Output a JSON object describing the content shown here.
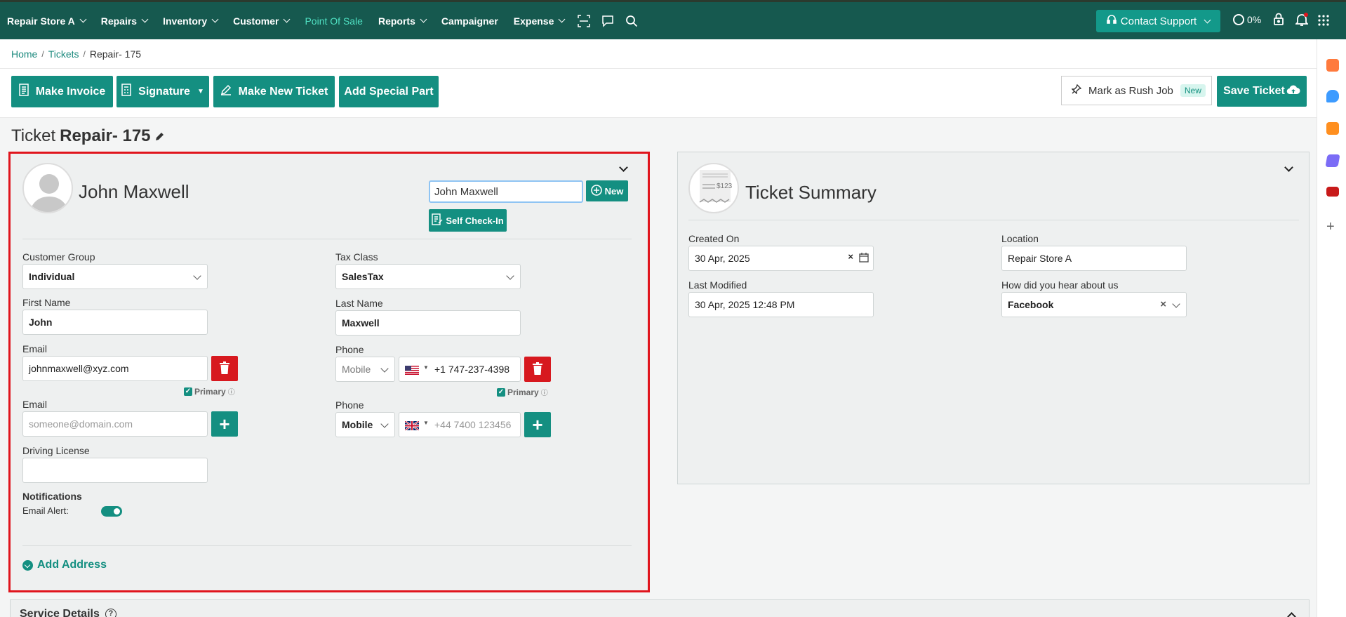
{
  "topnav": {
    "items": [
      {
        "label": "Repair Store A",
        "dropdown": true
      },
      {
        "label": "Repairs",
        "dropdown": true
      },
      {
        "label": "Inventory",
        "dropdown": true
      },
      {
        "label": "Customer",
        "dropdown": true
      },
      {
        "label": "Point Of Sale",
        "dropdown": false,
        "active": true
      },
      {
        "label": "Reports",
        "dropdown": true
      },
      {
        "label": "Campaigner",
        "dropdown": false
      },
      {
        "label": "Expense",
        "dropdown": true
      }
    ],
    "icons": [
      "scan-icon",
      "chat-icon",
      "search-icon"
    ],
    "support_label": "Contact Support",
    "progress": "0%",
    "right_icons": [
      "lock-icon",
      "bell-icon",
      "apps-grid-icon"
    ]
  },
  "breadcrumb": {
    "home": "Home",
    "tickets": "Tickets",
    "current": "Repair- 175"
  },
  "toolbar": {
    "make_invoice": "Make Invoice",
    "signature": "Signature",
    "make_new_ticket": "Make New Ticket",
    "add_special_part": "Add Special Part",
    "rush_job": "Mark as Rush Job",
    "rush_badge": "New",
    "save_ticket": "Save Ticket"
  },
  "page": {
    "title_prefix": "Ticket",
    "title_value": "Repair- 175"
  },
  "customer": {
    "name": "John Maxwell",
    "search_value": "John Maxwell",
    "new_label": "New",
    "self_checkin_label": "Self Check-In",
    "customer_group_label": "Customer Group",
    "customer_group": "Individual",
    "tax_class_label": "Tax Class",
    "tax_class": "SalesTax",
    "first_name_label": "First Name",
    "first_name": "John",
    "last_name_label": "Last Name",
    "last_name": "Maxwell",
    "email_label": "Email",
    "email": "johnmaxwell@xyz.com",
    "primary_label": "Primary",
    "email2_label": "Email",
    "email2_placeholder": "someone@domain.com",
    "phone_label": "Phone",
    "phone_type": "Mobile",
    "phone": "+1 747-237-4398",
    "phone2_label": "Phone",
    "phone2_type": "Mobile",
    "phone2_placeholder": "+44 7400 123456",
    "driving_license_label": "Driving License",
    "notifications_label": "Notifications",
    "email_alert_label": "Email Alert:",
    "email_alert_on": true,
    "add_address_label": "Add Address"
  },
  "summary": {
    "title": "Ticket Summary",
    "avatar_amount": "$123",
    "created_on_label": "Created On",
    "created_on": "30 Apr, 2025",
    "location_label": "Location",
    "location": "Repair Store A",
    "last_modified_label": "Last Modified",
    "last_modified": "30 Apr, 2025 12:48 PM",
    "hear_about_label": "How did you hear about us",
    "hear_about": "Facebook"
  },
  "service": {
    "title": "Service Details"
  },
  "colors": {
    "nav_bg": "#16594f",
    "accent": "#148f81",
    "danger": "#d7191f",
    "active_nav": "#4fe0c2"
  }
}
